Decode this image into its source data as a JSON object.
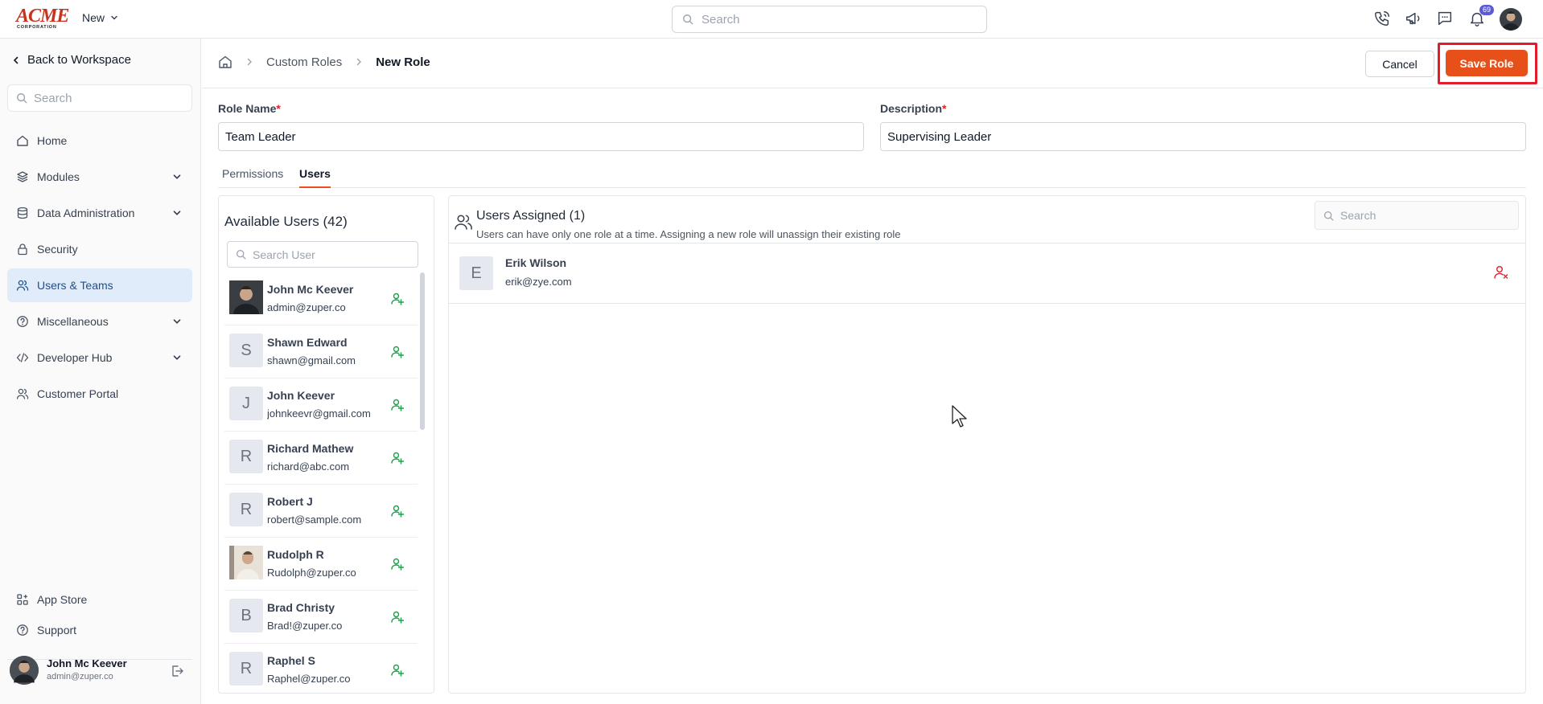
{
  "topbar": {
    "logo_text": "ACME",
    "logo_sub": "CORPORATION",
    "new_label": "New",
    "search_placeholder": "Search",
    "notification_count": "69",
    "icons": [
      "phone-icon",
      "megaphone-icon",
      "chat-icon",
      "bell-icon"
    ]
  },
  "sidebar": {
    "back_label": "Back to Workspace",
    "search_placeholder": "Search",
    "items": [
      {
        "label": "Home",
        "icon": "home-icon",
        "expandable": false
      },
      {
        "label": "Modules",
        "icon": "layers-icon",
        "expandable": true
      },
      {
        "label": "Data Administration",
        "icon": "database-icon",
        "expandable": true
      },
      {
        "label": "Security",
        "icon": "lock-icon",
        "expandable": false
      },
      {
        "label": "Users & Teams",
        "icon": "users-icon",
        "expandable": false,
        "active": true
      },
      {
        "label": "Miscellaneous",
        "icon": "help-circle-icon",
        "expandable": true
      },
      {
        "label": "Developer Hub",
        "icon": "code-icon",
        "expandable": true
      },
      {
        "label": "Customer Portal",
        "icon": "users-icon",
        "expandable": false
      }
    ],
    "footer_items": [
      {
        "label": "App Store",
        "icon": "apps-icon"
      },
      {
        "label": "Support",
        "icon": "help-circle-icon"
      }
    ],
    "user": {
      "name": "John Mc Keever",
      "email": "admin@zuper.co"
    }
  },
  "header": {
    "breadcrumb": [
      "Custom Roles",
      "New Role"
    ],
    "cancel_label": "Cancel",
    "save_label": "Save Role"
  },
  "form": {
    "role_name_label": "Role Name",
    "role_name_value": "Team Leader",
    "description_label": "Description",
    "description_value": "Supervising Leader",
    "required_mark": "*"
  },
  "tabs": [
    {
      "label": "Permissions",
      "active": false
    },
    {
      "label": "Users",
      "active": true
    }
  ],
  "available": {
    "title": "Available Users (42)",
    "search_placeholder": "Search User",
    "users": [
      {
        "name": "John Mc Keever",
        "email": "admin@zuper.co",
        "initial": "",
        "photo": true
      },
      {
        "name": "Shawn Edward",
        "email": "shawn@gmail.com",
        "initial": "S",
        "photo": false
      },
      {
        "name": "John Keever",
        "email": "johnkeevr@gmail.com",
        "initial": "J",
        "photo": false
      },
      {
        "name": "Richard Mathew",
        "email": "richard@abc.com",
        "initial": "R",
        "photo": false
      },
      {
        "name": "Robert J",
        "email": "robert@sample.com",
        "initial": "R",
        "photo": false
      },
      {
        "name": "Rudolph R",
        "email": "Rudolph@zuper.co",
        "initial": "",
        "photo": true
      },
      {
        "name": "Brad Christy",
        "email": "Brad!@zuper.co",
        "initial": "B",
        "photo": false
      },
      {
        "name": "Raphel S",
        "email": "Raphel@zuper.co",
        "initial": "R",
        "photo": false
      }
    ]
  },
  "assigned": {
    "title": "Users Assigned (1)",
    "subtitle": "Users can have only one role at a time. Assigning a new role will unassign their existing role",
    "search_placeholder": "Search",
    "users": [
      {
        "name": "Erik Wilson",
        "email": "erik@zye.com",
        "initial": "E"
      }
    ]
  },
  "colors": {
    "accent": "#e8501a",
    "active_nav_bg": "#e0ecf9",
    "add_icon": "#16a34a",
    "remove_icon": "#e11d2a",
    "highlight_frame": "#e11d2a"
  }
}
